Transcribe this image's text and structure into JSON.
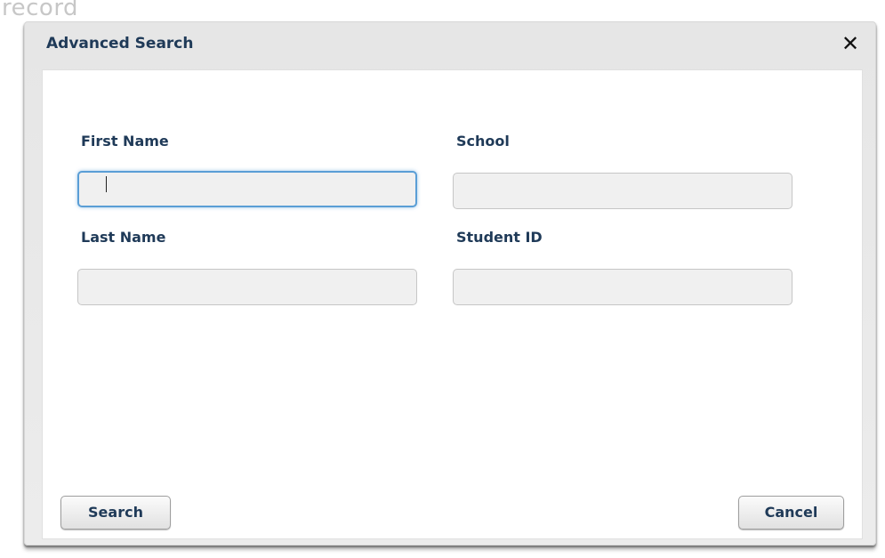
{
  "background": {
    "partial_text": "record"
  },
  "dialog": {
    "title": "Advanced Search",
    "close_glyph": "✕",
    "close_icon": "close-icon"
  },
  "form": {
    "first_name": {
      "label": "First Name",
      "value": "",
      "focused": true
    },
    "school": {
      "label": "School",
      "value": ""
    },
    "last_name": {
      "label": "Last Name",
      "value": ""
    },
    "student_id": {
      "label": "Student ID",
      "value": ""
    }
  },
  "actions": {
    "search_label": "Search",
    "cancel_label": "Cancel"
  },
  "colors": {
    "label_text": "#1f3a58",
    "focus_ring": "#5a9ed6",
    "field_bg": "#f0f0f0"
  }
}
